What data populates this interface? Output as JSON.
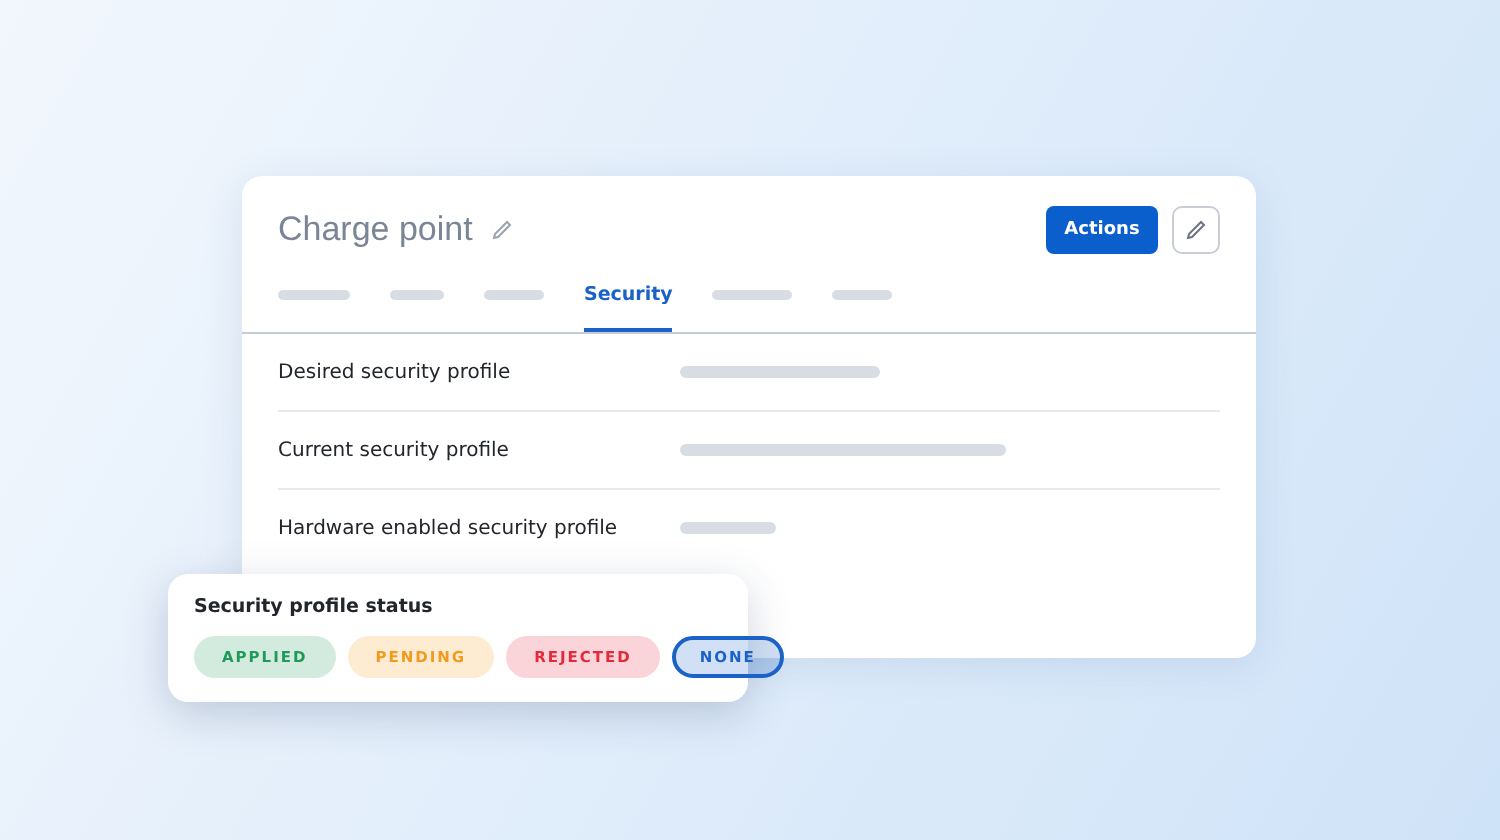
{
  "card": {
    "title": "Charge point",
    "actions_button": "Actions"
  },
  "tabs": [
    {
      "kind": "placeholder",
      "selected": false
    },
    {
      "kind": "placeholder",
      "selected": false
    },
    {
      "kind": "placeholder",
      "selected": false
    },
    {
      "kind": "label",
      "label": "Security",
      "selected": true
    },
    {
      "kind": "placeholder",
      "selected": false
    },
    {
      "kind": "placeholder",
      "selected": false
    }
  ],
  "rows": [
    {
      "label": "Desired security profile"
    },
    {
      "label": "Current security profile"
    },
    {
      "label": "Hardware enabled security profile"
    }
  ],
  "status_popup": {
    "title": "Security profile status",
    "chips": [
      {
        "label": "APPLIED",
        "color": "#1f9a5a",
        "selected": false
      },
      {
        "label": "PENDING",
        "color": "#f39a1e",
        "selected": false
      },
      {
        "label": "REJECTED",
        "color": "#e5293b",
        "selected": false
      },
      {
        "label": "NONE",
        "color": "#1a62c8",
        "selected": true
      }
    ]
  }
}
